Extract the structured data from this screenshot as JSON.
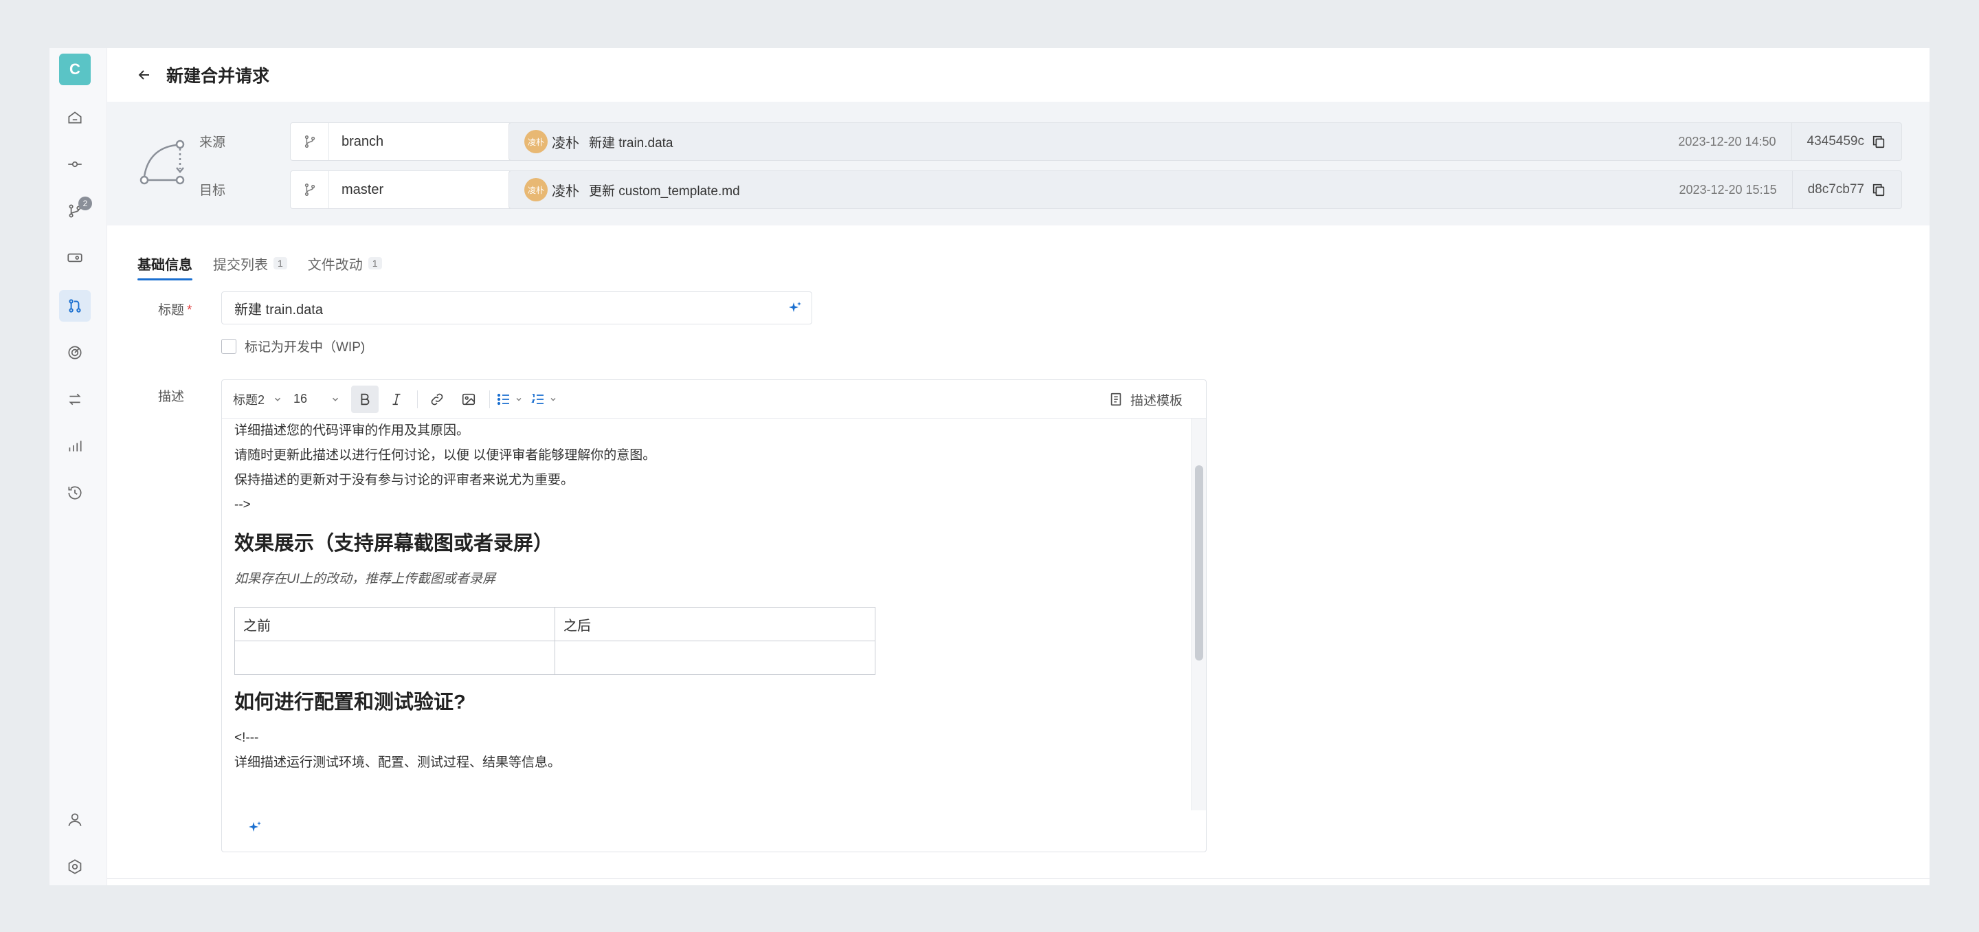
{
  "sidebar": {
    "logo": "C",
    "badge": "2"
  },
  "header": {
    "title": "新建合并请求"
  },
  "branches": {
    "source_label": "来源",
    "target_label": "目标",
    "source_branch": "branch",
    "target_branch": "master",
    "source_commit": {
      "avatar_text": "凌朴",
      "author": "凌朴",
      "message": "新建 train.data",
      "time": "2023-12-20 14:50",
      "sha": "4345459c"
    },
    "target_commit": {
      "avatar_text": "凌朴",
      "author": "凌朴",
      "message": "更新 custom_template.md",
      "time": "2023-12-20 15:15",
      "sha": "d8c7cb77"
    }
  },
  "tabs": [
    {
      "label": "基础信息",
      "count": ""
    },
    {
      "label": "提交列表",
      "count": "1"
    },
    {
      "label": "文件改动",
      "count": "1"
    }
  ],
  "form": {
    "title_label": "标题",
    "required_mark": "*",
    "title_value": "新建 train.data",
    "wip_label": "标记为开发中（WIP)",
    "desc_label": "描述"
  },
  "toolbar": {
    "heading": "标题2",
    "font_size": "16",
    "template_label": "描述模板"
  },
  "content": {
    "line1": "详细描述您的代码评审的作用及其原因。",
    "line2": "请随时更新此描述以进行任何讨论，以便 以便评审者能够理解你的意图。",
    "line3": "保持描述的更新对于没有参与讨论的评审者来说尤为重要。",
    "line4": "-->",
    "h_effect": "效果展示（支持屏幕截图或者录屏）",
    "effect_hint": "如果存在UI上的改动，推荐上传截图或者录屏",
    "table_before": "之前",
    "table_after": "之后",
    "h_config": "如何进行配置和测试验证?",
    "line5": "<!---",
    "line6": "详细描述运行测试环境、配置、测试过程、结果等信息。"
  }
}
